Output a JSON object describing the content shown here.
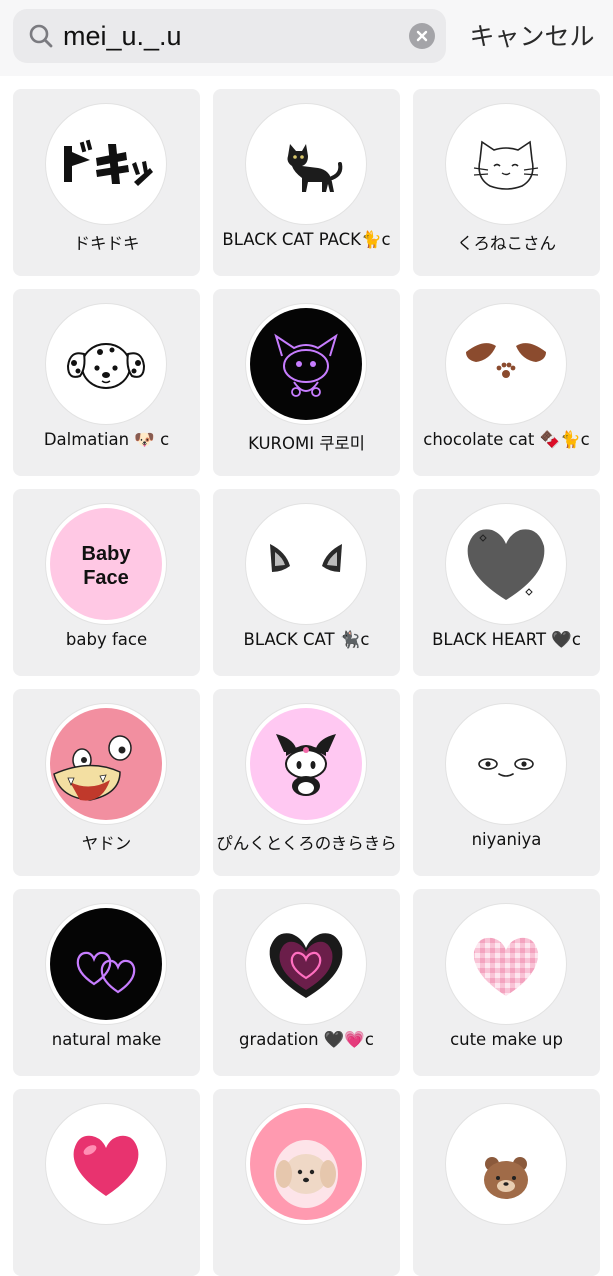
{
  "search": {
    "value": "mei_u._.u",
    "cancel_label": "キャンセル"
  },
  "filters": [
    {
      "name": "ドキドキ",
      "icon": "doki-text-icon"
    },
    {
      "name": "BLACK CAT PACK🐈c",
      "icon": "black-cat-icon"
    },
    {
      "name": "くろねこさん",
      "icon": "cat-line-drawing-icon"
    },
    {
      "name": "Dalmatian 🐶 c",
      "icon": "dalmatian-icon"
    },
    {
      "name": "KUROMI 쿠로미",
      "icon": "kuromi-neon-icon"
    },
    {
      "name": "chocolate cat 🍫🐈c",
      "icon": "brown-cat-ears-icon"
    },
    {
      "name": "baby face",
      "icon": "baby-face-text-icon",
      "icon_text": [
        "Baby",
        "Face"
      ]
    },
    {
      "name": "BLACK CAT 🐈‍⬛c",
      "icon": "cat-ears-icon"
    },
    {
      "name": "BLACK HEART 🖤c",
      "icon": "black-heart-icon"
    },
    {
      "name": "ヤドン",
      "icon": "slowpoke-icon"
    },
    {
      "name": "ぴんくとくろのきらきら",
      "icon": "kuromi-pink-icon"
    },
    {
      "name": "niyaniya",
      "icon": "smirk-eyes-icon"
    },
    {
      "name": "natural make",
      "icon": "neon-hearts-icon"
    },
    {
      "name": "gradation 🖤💗c",
      "icon": "glow-heart-icon"
    },
    {
      "name": "cute make up",
      "icon": "gingham-heart-icon"
    },
    {
      "name": "",
      "icon": "pink-heart-icon"
    },
    {
      "name": "",
      "icon": "puppy-icon"
    },
    {
      "name": "",
      "icon": "bear-icon"
    }
  ],
  "colors": {
    "search_bg": "#eaeaec",
    "tile_bg": "#efeff0",
    "kuromi_purple": "#c77dff",
    "pink": "#ffc8e4"
  }
}
